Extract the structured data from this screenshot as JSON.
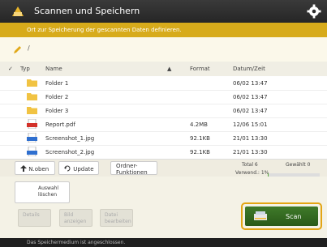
{
  "window": {
    "title": "Scannen und Speichern",
    "banner": "Ort zur Speicherung der gescannten Daten definieren.",
    "path": "/"
  },
  "table": {
    "headers": {
      "check": "✓",
      "type": "Typ",
      "name": "Name",
      "sort_icon": "▲",
      "format": "Format",
      "date": "Datum/Zeit"
    },
    "rows": [
      {
        "icon": "folder-icon",
        "name": "Folder 1",
        "format": "",
        "date": "06/02 13:47"
      },
      {
        "icon": "folder-icon",
        "name": "Folder 2",
        "format": "",
        "date": "06/02 13:47"
      },
      {
        "icon": "folder-icon",
        "name": "Folder 3",
        "format": "",
        "date": "06/02 13:47"
      },
      {
        "icon": "pdf-icon",
        "name": "Report.pdf",
        "format": "4.2MB",
        "date": "12/06 15:01"
      },
      {
        "icon": "image-icon",
        "name": "Screenshot_1.jpg",
        "format": "92.1KB",
        "date": "21/01 13:30"
      },
      {
        "icon": "image-icon",
        "name": "Screenshot_2.jpg",
        "format": "92.1KB",
        "date": "21/01 13:30"
      }
    ]
  },
  "toolbar": {
    "up": "N.oben",
    "update": "Update",
    "menu_line1": "Ordner-",
    "menu_line2": "Funktionen",
    "total": "Total 6",
    "selected": "Gewählt 0",
    "used": "Verwend.: 1%",
    "used_percent": 1
  },
  "lower": {
    "select_all_1": "Auswahl",
    "select_all_2": "löschen",
    "details": "Details",
    "scan": "Scan",
    "edit_1": "Bild",
    "edit_2": "anzeigen",
    "delete_1": "Datei",
    "delete_2": "bearbeiten"
  },
  "status": "Das Speichermedium ist angeschlossen."
}
